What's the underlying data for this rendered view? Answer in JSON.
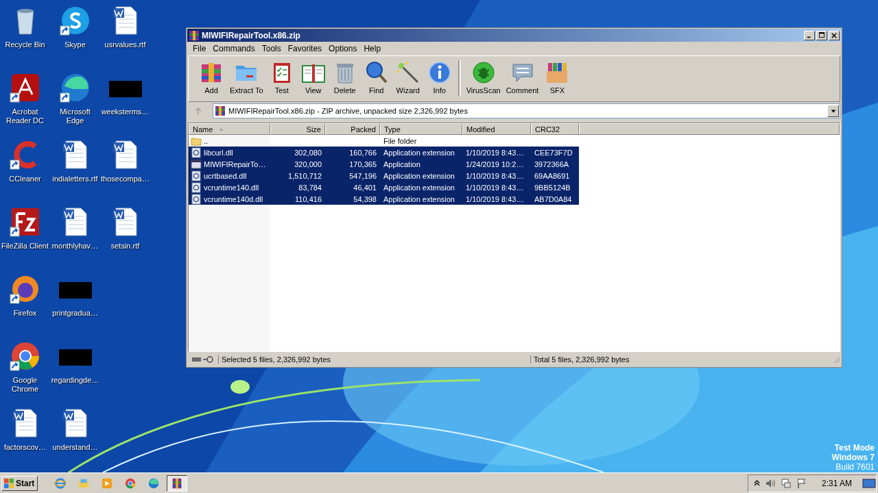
{
  "desktop": {
    "icons": [
      {
        "label": "Recycle Bin",
        "kind": "recycle",
        "shortcut": false
      },
      {
        "label": "Acrobat Reader DC",
        "kind": "acrobat",
        "shortcut": true
      },
      {
        "label": "CCleaner",
        "kind": "ccleaner",
        "shortcut": true
      },
      {
        "label": "FileZilla Client",
        "kind": "filezilla",
        "shortcut": true
      },
      {
        "label": "Firefox",
        "kind": "firefox",
        "shortcut": true
      },
      {
        "label": "Google Chrome",
        "kind": "chrome",
        "shortcut": true
      },
      {
        "label": "factorscov…",
        "kind": "word",
        "shortcut": false
      },
      {
        "label": "Skype",
        "kind": "skype",
        "shortcut": true
      },
      {
        "label": "Microsoft Edge",
        "kind": "edge",
        "shortcut": true
      },
      {
        "label": "indialetters.rtf",
        "kind": "word",
        "shortcut": false
      },
      {
        "label": "monthlyhav…",
        "kind": "word",
        "shortcut": false
      },
      {
        "label": "printgradua…",
        "kind": "redacted",
        "shortcut": false
      },
      {
        "label": "regardingde…",
        "kind": "redacted",
        "shortcut": false
      },
      {
        "label": "understand…",
        "kind": "word",
        "shortcut": false
      },
      {
        "label": "usrvalues.rtf",
        "kind": "word",
        "shortcut": false
      },
      {
        "label": "weeksterms…",
        "kind": "redacted",
        "shortcut": false
      },
      {
        "label": "thosecompa…",
        "kind": "word",
        "shortcut": false
      },
      {
        "label": "setsin.rtf",
        "kind": "word",
        "shortcut": false
      }
    ],
    "watermark": [
      "Test Mode",
      "Windows 7",
      "Build 7601"
    ]
  },
  "window": {
    "title": "MIWIFIRepairTool.x86.zip",
    "menu": [
      "File",
      "Commands",
      "Tools",
      "Favorites",
      "Options",
      "Help"
    ],
    "toolbar": [
      {
        "buttons": [
          {
            "label": "Add",
            "kind": "add"
          },
          {
            "label": "Extract To",
            "kind": "extract"
          },
          {
            "label": "Test",
            "kind": "test"
          },
          {
            "label": "View",
            "kind": "view"
          },
          {
            "label": "Delete",
            "kind": "delete"
          },
          {
            "label": "Find",
            "kind": "find"
          },
          {
            "label": "Wizard",
            "kind": "wizard"
          },
          {
            "label": "Info",
            "kind": "info"
          }
        ]
      },
      {
        "buttons": [
          {
            "label": "VirusScan",
            "kind": "virus"
          },
          {
            "label": "Comment",
            "kind": "comment"
          },
          {
            "label": "SFX",
            "kind": "sfx"
          }
        ]
      }
    ],
    "address": "MIWIFIRepairTool.x86.zip - ZIP archive, unpacked size 2,326,992 bytes",
    "columns": [
      "Name",
      "Size",
      "Packed",
      "Type",
      "Modified",
      "CRC32"
    ],
    "rows": [
      {
        "kind": "folder",
        "cells": [
          "..",
          "",
          "",
          "File folder",
          "",
          ""
        ],
        "selected": false
      },
      {
        "kind": "dll",
        "cells": [
          "libcurl.dll",
          "302,080",
          "160,766",
          "Application extension",
          "1/10/2019 8:43…",
          "CEE73F7D"
        ],
        "selected": true
      },
      {
        "kind": "exe",
        "cells": [
          "MIWIFIRepairTo…",
          "320,000",
          "170,365",
          "Application",
          "1/24/2019 10:2…",
          "3972366A"
        ],
        "selected": true
      },
      {
        "kind": "dll",
        "cells": [
          "ucrtbased.dll",
          "1,510,712",
          "547,196",
          "Application extension",
          "1/10/2019 8:43…",
          "69AA8691"
        ],
        "selected": true
      },
      {
        "kind": "dll",
        "cells": [
          "vcruntime140.dll",
          "83,784",
          "46,401",
          "Application extension",
          "1/10/2019 8:43…",
          "9BB5124B"
        ],
        "selected": true
      },
      {
        "kind": "dll",
        "cells": [
          "vcruntime140d.dll",
          "110,416",
          "54,398",
          "Application extension",
          "1/10/2019 8:43…",
          "AB7D0A84"
        ],
        "selected": true
      }
    ],
    "status": [
      "Selected 5 files, 2,326,992 bytes",
      "Total 5 files, 2,326,992 bytes"
    ]
  },
  "taskbar": {
    "start": "Start",
    "items": [
      {
        "kind": "ie",
        "selected": false
      },
      {
        "kind": "explorer",
        "selected": false
      },
      {
        "kind": "media",
        "selected": false
      },
      {
        "kind": "chrome",
        "selected": false
      },
      {
        "kind": "edge",
        "selected": false
      },
      {
        "kind": "winrar",
        "selected": true
      }
    ],
    "time": "2:31 AM"
  }
}
